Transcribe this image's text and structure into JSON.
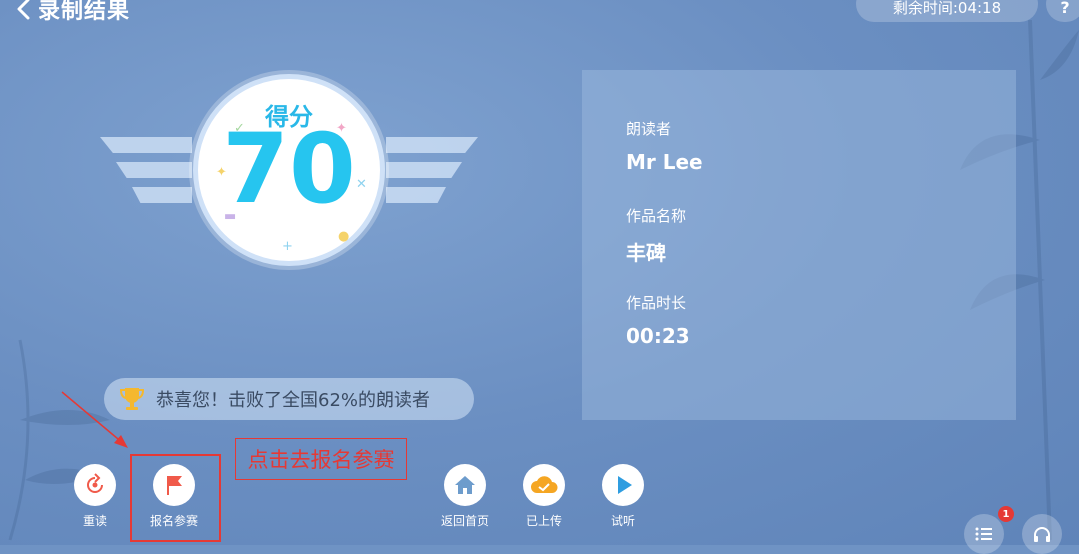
{
  "header": {
    "title": "录制结果",
    "timer": "剩余时间:04:18",
    "help": "?"
  },
  "score": {
    "label": "得分",
    "value": "70"
  },
  "info": {
    "reader_label": "朗读者",
    "reader_value": "Mr Lee",
    "work_label": "作品名称",
    "work_value": "丰碑",
    "duration_label": "作品时长",
    "duration_value": "00:23"
  },
  "congrats": "恭喜您！击败了全国62%的朗读者",
  "actions": {
    "reread": "重读",
    "signup": "报名参赛",
    "home": "返回首页",
    "uploaded": "已上传",
    "listen": "试听"
  },
  "annotation": "点击去报名参赛",
  "playlist_badge": "1",
  "colors": {
    "accent": "#26c5ef",
    "flag": "#f05a4a",
    "upload": "#f5a623",
    "play": "#2f9de0",
    "annotation": "#e53935"
  }
}
